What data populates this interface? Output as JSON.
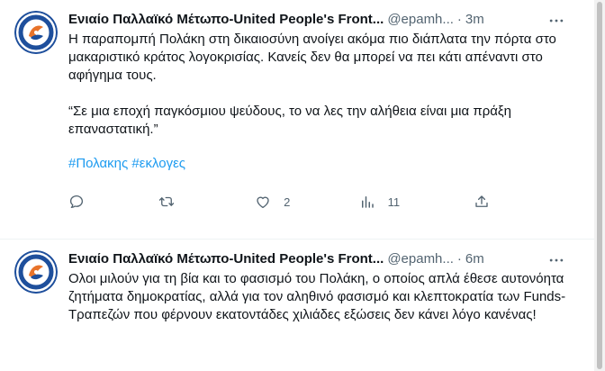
{
  "colors": {
    "text": "#0f1419",
    "secondary": "#536471",
    "link": "#1d9bf0",
    "avatar_blue": "#1e4f9c",
    "avatar_orange": "#e8732a"
  },
  "tweets": [
    {
      "author_name": "Ενιαίο Παλλαϊκό Μέτωπο-United People's Front...",
      "handle": "@epamh...",
      "separator": "·",
      "time": "3m",
      "more_icon": "more-horizontal-icon",
      "text": "Η παραπομπή Πολάκη στη δικαιοσύνη ανοίγει ακόμα πιο διάπλατα την πόρτα στο μακαριστικό κράτος λογοκρισίας. Κανείς δεν θα μπορεί να πει κάτι απέναντι στο αφήγημα τους.\n\n“Σε μια εποχή παγκόσμιου ψεύδους, το να λες την αλήθεια είναι μια πράξη επαναστατική.”",
      "hashtags": [
        "#Πολακης",
        "#εκλογες"
      ],
      "actions": {
        "reply_count": "",
        "retweet_count": "",
        "like_count": "2",
        "views_count": "11"
      }
    },
    {
      "author_name": "Ενιαίο Παλλαϊκό Μέτωπο-United People's Front...",
      "handle": "@epamh...",
      "separator": "·",
      "time": "6m",
      "more_icon": "more-horizontal-icon",
      "text": "Ολοι μιλούν για τη βία και το φασισμό του Πολάκη, ο οποίος απλά έθεσε αυτονόητα ζητήματα δημοκρατίας, αλλά για τον αληθινό φασισμό και κλεπτοκρατία των Funds-Τραπεζών που φέρνουν εκατοντάδες χιλιάδες εξώσεις δεν κάνει λόγο κανένας!"
    }
  ]
}
